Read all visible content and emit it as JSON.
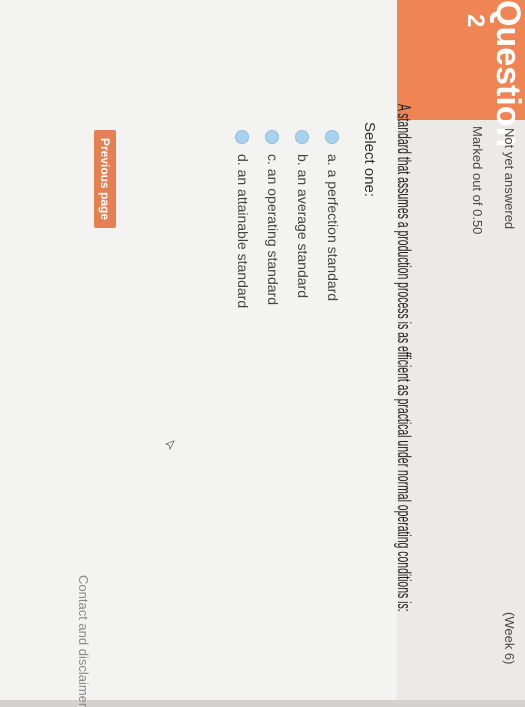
{
  "header": {
    "question_word": "Question",
    "question_number": "2",
    "state_label": "Not yet answered",
    "week_label": "(Week 6)",
    "marks_label": "Marked out of 0.50",
    "previous_button": "Previous page"
  },
  "question": {
    "text": "A standard that assumes a production process is as efficient as practical under normal operating conditions is:",
    "prompt": "Select one:",
    "options": [
      "a. a perfection standard",
      "b. an average standard",
      "c. an operating standard",
      "d. an attainable standard"
    ]
  },
  "footer": {
    "link_text": "Contact and disclaimer"
  },
  "colors": {
    "accent": "#ef8454",
    "radio": "#a9d2ee"
  }
}
